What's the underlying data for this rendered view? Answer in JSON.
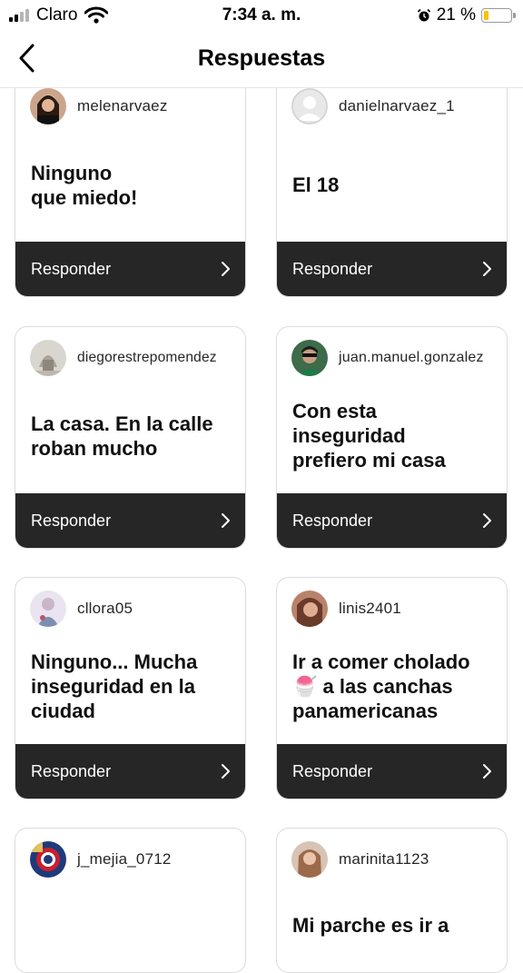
{
  "status_bar": {
    "carrier": "Claro",
    "time": "7:34 a. m.",
    "battery": "21 %",
    "battery_level": 0.21,
    "icons": [
      "signal-icon",
      "wifi-icon",
      "alarm-icon",
      "battery-icon"
    ]
  },
  "header": {
    "title": "Respuestas",
    "back_icon": "chevron-left-icon"
  },
  "colors": {
    "button_bg": "#262626",
    "card_border": "#dcdcdc",
    "battery_fill": "#f5c400"
  },
  "reply_label": "Responder",
  "cards": [
    {
      "username": "melenarvaez",
      "answer": "Ninguno\nque miedo!"
    },
    {
      "username": "danielnarvaez_1",
      "answer": "El 18"
    },
    {
      "username": "diegorestrepomendez",
      "answer": "La casa. En la calle\nroban mucho"
    },
    {
      "username": "juan.manuel.gonzalez",
      "answer": "Con esta\ninseguridad\nprefiero mi casa"
    },
    {
      "username": "cllora05",
      "answer": "Ninguno... Mucha\ninseguridad en la\nciudad"
    },
    {
      "username": "linis2401",
      "answer": "Ir a comer cholado\n🍧 a las canchas\npanamericanas"
    },
    {
      "username": "j_mejia_0712",
      "answer": ""
    },
    {
      "username": "marinita1123",
      "answer": "Mi parche es ir a"
    }
  ]
}
